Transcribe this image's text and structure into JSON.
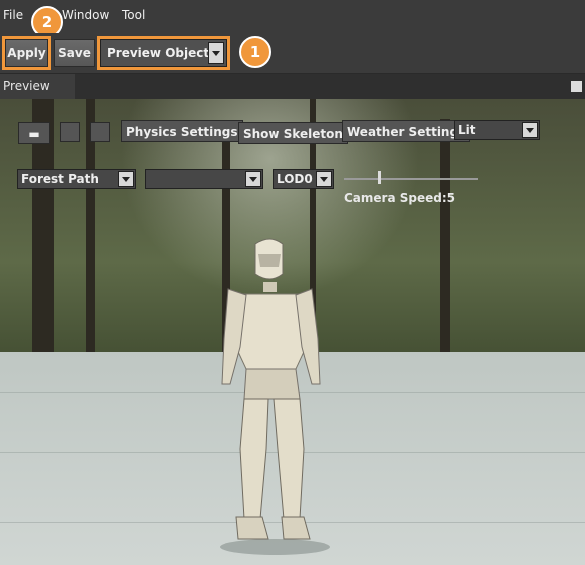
{
  "menu": {
    "file": "File",
    "window": "Window",
    "tool": "Tool"
  },
  "toolbar": {
    "apply": "Apply",
    "save": "Save",
    "preview_object": "Preview Object"
  },
  "badges": {
    "one": "1",
    "two": "2"
  },
  "panel": {
    "tab": "Preview"
  },
  "viewport": {
    "physics": "Physics Settings",
    "skeleton": "Show Skeleton",
    "weather": "Weather Settings",
    "lighting": "Lit",
    "environment": "Forest Path",
    "empty_select": "",
    "lod": "LOD0",
    "camera_speed_label": "Camera Speed:5",
    "camera_speed_value": 5
  },
  "colors": {
    "accent": "#f0973b",
    "panel": "#3b3b3b"
  },
  "icons": [
    "camera-menu-icon",
    "refresh-icon",
    "grid-icon",
    "pin-icon",
    "dropdown-arrow-icon"
  ]
}
